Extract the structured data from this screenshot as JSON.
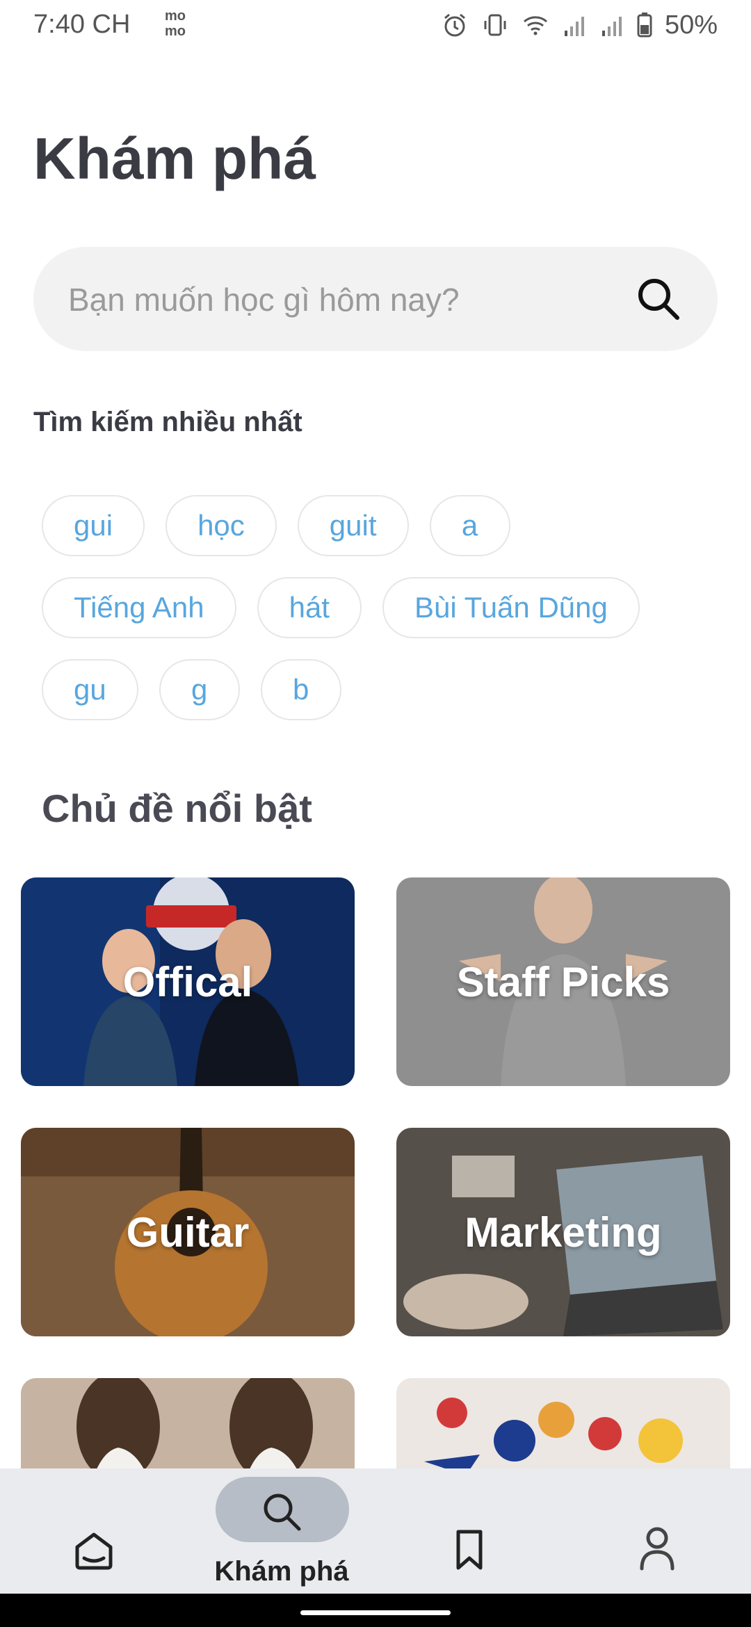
{
  "status_bar": {
    "time": "7:40 CH",
    "app_icon": "momo-icon",
    "battery": "50%"
  },
  "page_title": "Khám phá",
  "search": {
    "placeholder": "Bạn muốn học gì hôm nay?",
    "value": ""
  },
  "popular": {
    "heading": "Tìm kiếm nhiều nhất",
    "rows": [
      [
        "gui",
        "học",
        "guit",
        "a"
      ],
      [
        "Tiếng Anh",
        "hát",
        "Bùi Tuấn Dũng"
      ],
      [
        "gu",
        "g",
        "b"
      ]
    ]
  },
  "featured": {
    "heading": "Chủ đề nổi bật",
    "cards": [
      {
        "label": "Offical",
        "color": "#0d2a5c"
      },
      {
        "label": "Staff Picks",
        "color": "#8d8d8d"
      },
      {
        "label": "Guitar",
        "color": "#6a4a2a"
      },
      {
        "label": "Marketing",
        "color": "#5b5248"
      },
      {
        "label": "",
        "color": "#c9b8a8"
      },
      {
        "label": "",
        "color": "#e9e4e0"
      }
    ]
  },
  "bottom_nav": {
    "items": [
      {
        "icon": "home-icon"
      },
      {
        "icon": "search-icon",
        "label": "Khám phá",
        "active": true
      },
      {
        "icon": "bookmark-icon"
      },
      {
        "icon": "profile-icon"
      }
    ]
  }
}
